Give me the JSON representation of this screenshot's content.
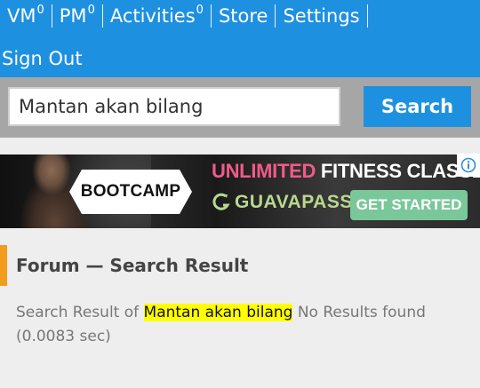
{
  "nav": {
    "items": [
      {
        "label": "VM",
        "badge": "0"
      },
      {
        "label": "PM",
        "badge": "0"
      },
      {
        "label": "Activities",
        "badge": "0"
      },
      {
        "label": "Store",
        "badge": ""
      },
      {
        "label": "Settings",
        "badge": ""
      }
    ],
    "signout": "Sign Out"
  },
  "search": {
    "value": "Mantan akan bilang",
    "button": "Search"
  },
  "ad": {
    "badge": "BOOTCAMP",
    "title_part1": "UNLIMITED",
    "title_part2": "FITNESS CLASSES",
    "logo_text": "GUAVAPASS",
    "cta": "GET STARTED",
    "info_icon": "info-icon"
  },
  "forum": {
    "title": "Forum — Search Result",
    "result_prefix": "Search Result of",
    "query": "Mantan akan bilang",
    "result_suffix": "No Results found",
    "time": "(0.0083 sec)"
  },
  "colors": {
    "nav_bg": "#1e90e0",
    "accent": "#f39c1e",
    "highlight": "#ffff00",
    "cta_bg": "#7ac79a"
  }
}
